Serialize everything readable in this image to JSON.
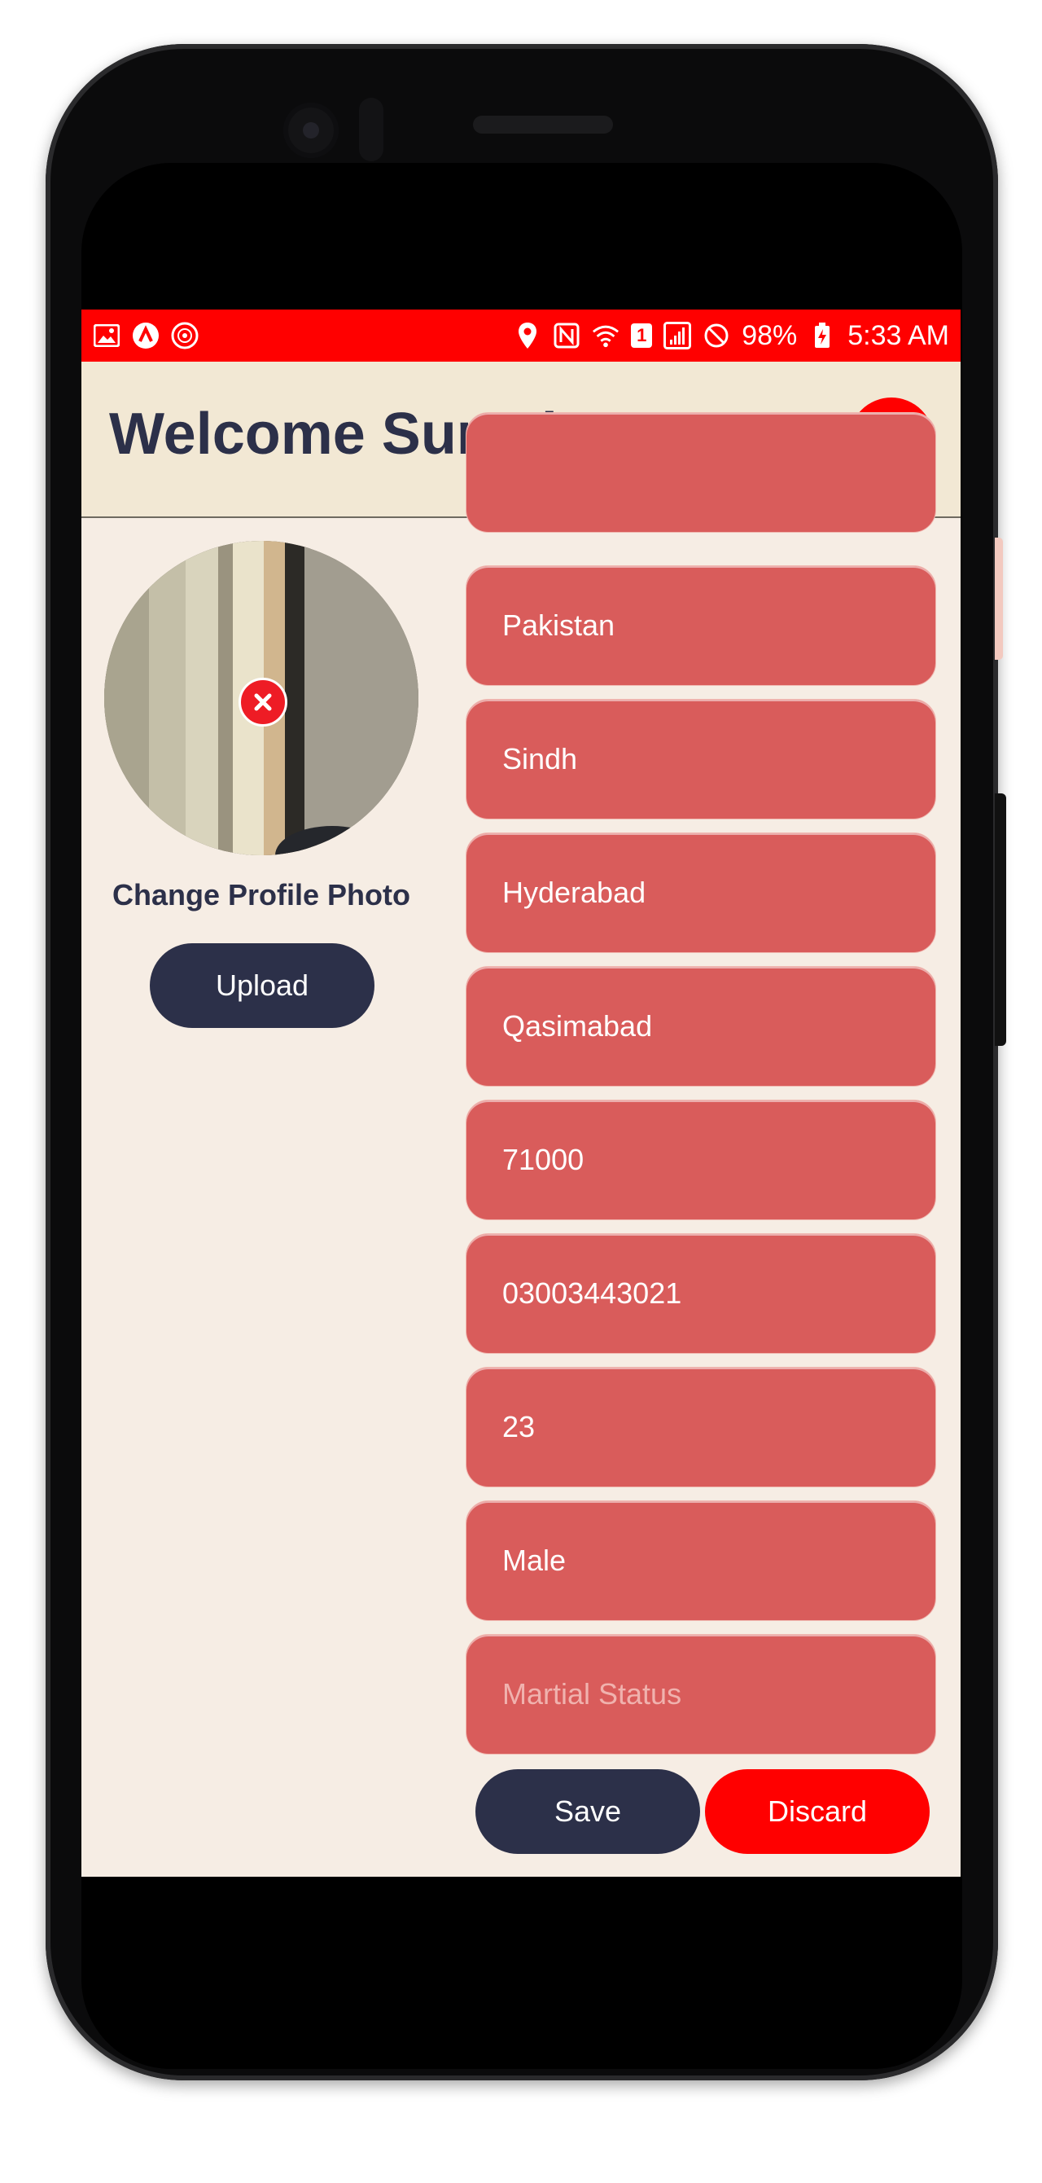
{
  "status_bar": {
    "battery": "98%",
    "time": "5:33 AM",
    "sim_slot": "1"
  },
  "header": {
    "title": "Welcome Sumair"
  },
  "profile": {
    "change_label": "Change Profile Photo",
    "upload_label": "Upload"
  },
  "fields": [
    {
      "value": "",
      "placeholder": ""
    },
    {
      "value": "Pakistan",
      "placeholder": ""
    },
    {
      "value": "Sindh",
      "placeholder": ""
    },
    {
      "value": "Hyderabad",
      "placeholder": ""
    },
    {
      "value": "Qasimabad",
      "placeholder": ""
    },
    {
      "value": "71000",
      "placeholder": ""
    },
    {
      "value": "03003443021",
      "placeholder": ""
    },
    {
      "value": "23",
      "placeholder": ""
    },
    {
      "value": "Male",
      "placeholder": ""
    },
    {
      "value": "",
      "placeholder": "Martial Status"
    }
  ],
  "actions": {
    "save_label": "Save",
    "discard_label": "Discard"
  },
  "colors": {
    "status_bar": "#ff0000",
    "header_bg": "#f2e8d4",
    "screen_bg": "#f6ede4",
    "field_bg": "#d95c5b",
    "primary_dark": "#2c3049",
    "danger": "#ff0000"
  }
}
